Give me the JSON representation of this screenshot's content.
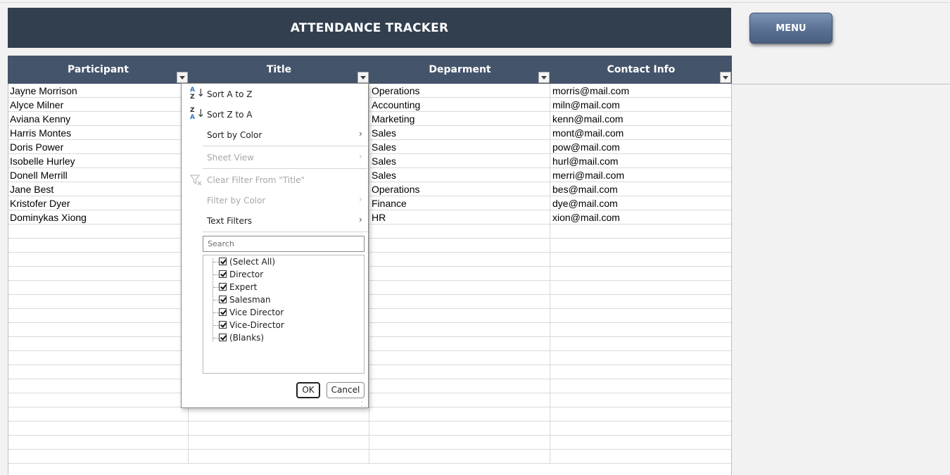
{
  "title": "ATTENDANCE TRACKER",
  "menu_button": "MENU",
  "colors": {
    "title_bg": "#323f4f",
    "header_bg": "#44546a",
    "menu_btn": "#5a7093"
  },
  "table": {
    "headers": [
      "Participant",
      "Title",
      "Deparment",
      "Contact Info"
    ],
    "rows": [
      [
        "Jayne Morrison",
        "",
        "Operations",
        "morris@mail.com"
      ],
      [
        "Alyce Milner",
        "",
        "Accounting",
        "miln@mail.com"
      ],
      [
        "Aviana Kenny",
        "",
        "Marketing",
        "kenn@mail.com"
      ],
      [
        "Harris Montes",
        "",
        "Sales",
        "mont@mail.com"
      ],
      [
        "Doris Power",
        "",
        "Sales",
        "pow@mail.com"
      ],
      [
        "Isobelle Hurley",
        "",
        "Sales",
        "hurl@mail.com"
      ],
      [
        "Donell Merrill",
        "",
        "Sales",
        "merri@mail.com"
      ],
      [
        "Jane Best",
        "",
        "Operations",
        "bes@mail.com"
      ],
      [
        "Kristofer Dyer",
        "",
        "Finance",
        "dye@mail.com"
      ],
      [
        "Dominykas Xiong",
        "",
        "HR",
        "xion@mail.com"
      ]
    ]
  },
  "filter_menu": {
    "sort_asc": "Sort A to Z",
    "sort_desc": "Sort Z to A",
    "sort_by_color": "Sort by Color",
    "sheet_view": "Sheet View",
    "clear_filter": "Clear Filter From \"Title\"",
    "filter_by_color": "Filter by Color",
    "text_filters": "Text Filters",
    "search_placeholder": "Search",
    "items": [
      "(Select All)",
      "Director",
      "Expert",
      "Salesman",
      "Vice Director",
      "Vice-Director",
      "(Blanks)"
    ],
    "ok": "OK",
    "cancel": "Cancel"
  }
}
